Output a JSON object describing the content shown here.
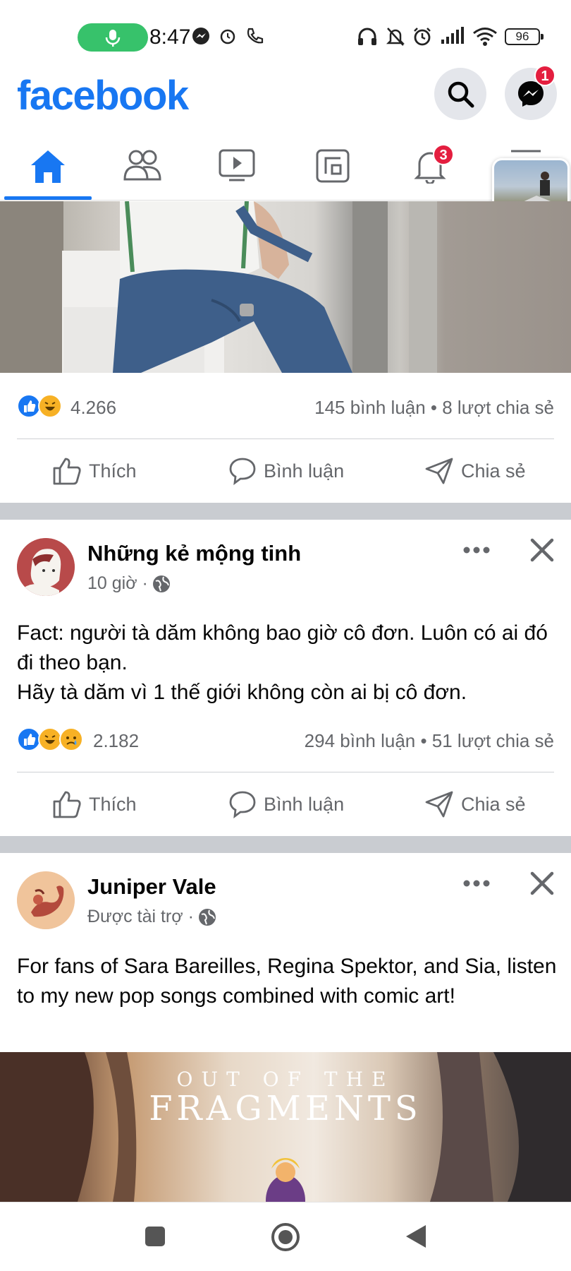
{
  "status_bar": {
    "time": "8:47",
    "battery": "96"
  },
  "header": {
    "logo": "facebook",
    "messenger_badge": "1"
  },
  "tabs": {
    "notifications_badge": "3"
  },
  "post1": {
    "reaction_count": "4.266",
    "comments_shares": "145 bình luận • 8 lượt chia sẻ"
  },
  "actions": {
    "like": "Thích",
    "comment": "Bình luận",
    "share": "Chia sẻ"
  },
  "post2": {
    "author": "Những kẻ mộng tinh",
    "time": "10 giờ ·",
    "text": "Fact: người tà dăm không bao giờ cô đơn. Luôn có ai đó đi theo bạn.\nHãy tà dăm vì 1 thế giới không còn ai bị cô đơn.",
    "reaction_count": "2.182",
    "comments_shares": "294 bình luận • 51 lượt chia sẻ"
  },
  "post3": {
    "author": "Juniper Vale",
    "sponsored": "Được tài trợ ·",
    "text": "For fans of Sara Bareilles, Regina Spektor, and Sia, listen to my new pop songs combined with comic art!",
    "image_title_small": "OUT OF THE",
    "image_title_big": "FRAGMENTS"
  },
  "colors": {
    "brand": "#1877f2",
    "badge": "#e41e3f",
    "secondary_text": "#65676b",
    "separator": "#c9ccd1"
  },
  "icons": [
    "mic-icon",
    "messenger-icon",
    "alarm-icon",
    "call-icon",
    "headphones-icon",
    "mute-icon",
    "wifi-icon",
    "signal-icon",
    "search-icon",
    "home-icon",
    "friends-icon",
    "video-icon",
    "gaming-icon",
    "bell-icon",
    "menu-icon",
    "like-icon",
    "comment-icon",
    "share-icon",
    "globe-icon",
    "more-icon",
    "close-icon",
    "recent-apps-icon",
    "home-nav-icon",
    "back-icon"
  ]
}
